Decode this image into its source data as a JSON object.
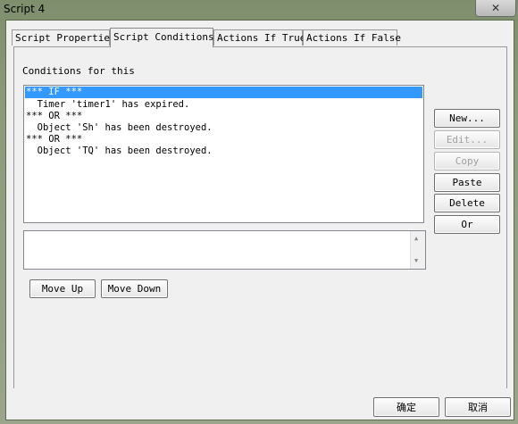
{
  "window": {
    "title": "Script 4",
    "close_glyph": "✕"
  },
  "tabs": [
    {
      "label": "Script Properties",
      "active": false
    },
    {
      "label": "Script Conditions",
      "active": true
    },
    {
      "label": "Actions If True",
      "active": false
    },
    {
      "label": "Actions If False",
      "active": false
    }
  ],
  "conditions": {
    "label": "Conditions for this",
    "items": [
      "*** IF ***",
      "  Timer 'timer1' has expired.",
      "*** OR ***",
      "  Object 'Sh' has been destroyed.",
      "*** OR ***",
      "  Object 'TQ' has been destroyed."
    ],
    "selected_index": 0
  },
  "side_buttons": {
    "new": "New...",
    "edit": "Edit...",
    "copy": "Copy",
    "paste": "Paste",
    "delete": "Delete",
    "or": "Or"
  },
  "move_buttons": {
    "up": "Move Up",
    "down": "Move Down"
  },
  "footer_buttons": {
    "ok": "确定",
    "cancel": "取消"
  }
}
